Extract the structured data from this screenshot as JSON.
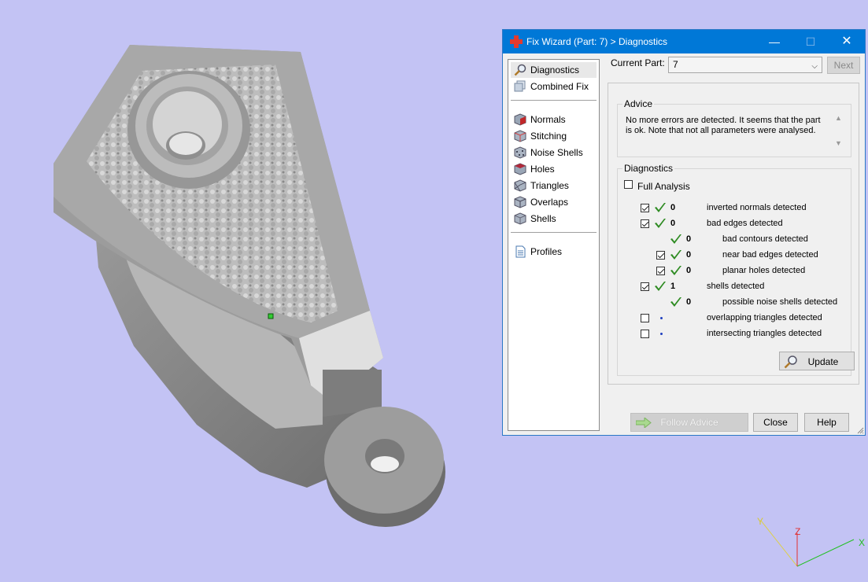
{
  "window": {
    "title": "Fix Wizard (Part: 7) > Diagnostics",
    "minimize": "—",
    "maximize": "☐",
    "close": "✕"
  },
  "nav": {
    "items": [
      {
        "label": "Diagnostics",
        "icon": "magnifier-icon",
        "selected": true
      },
      {
        "label": "Combined Fix",
        "icon": "combined-fix-icon"
      },
      {
        "label": "Normals",
        "icon": "normals-cube-icon"
      },
      {
        "label": "Stitching",
        "icon": "stitching-cube-icon"
      },
      {
        "label": "Noise Shells",
        "icon": "noise-shells-cube-icon"
      },
      {
        "label": "Holes",
        "icon": "holes-cube-icon"
      },
      {
        "label": "Triangles",
        "icon": "triangles-cube-icon"
      },
      {
        "label": "Overlaps",
        "icon": "overlaps-cube-icon"
      },
      {
        "label": "Shells",
        "icon": "shells-cube-icon"
      },
      {
        "label": "Profiles",
        "icon": "profiles-document-icon"
      }
    ]
  },
  "part": {
    "label": "Current Part:",
    "value": "7",
    "next": "Next"
  },
  "advice": {
    "title": "Advice",
    "text": "No more errors are detected. It seems that the part is ok. Note that not all parameters were analysed."
  },
  "diagnostics": {
    "title": "Diagnostics",
    "full_analysis": "Full Analysis",
    "rows": [
      {
        "checkbox": true,
        "checked": true,
        "status": "ok",
        "count": "0",
        "label": "inverted normals detected",
        "indent": 0
      },
      {
        "checkbox": true,
        "checked": true,
        "status": "ok",
        "count": "0",
        "label": "bad edges detected",
        "indent": 0
      },
      {
        "checkbox": false,
        "checked": false,
        "status": "ok",
        "count": "0",
        "label": "bad contours detected",
        "indent": 1
      },
      {
        "checkbox": true,
        "checked": true,
        "status": "ok",
        "count": "0",
        "label": "near bad edges detected",
        "indent": 1
      },
      {
        "checkbox": true,
        "checked": true,
        "status": "ok",
        "count": "0",
        "label": "planar holes detected",
        "indent": 1
      },
      {
        "checkbox": true,
        "checked": true,
        "status": "ok",
        "count": "1",
        "label": "shells detected",
        "indent": 0
      },
      {
        "checkbox": false,
        "checked": false,
        "status": "ok",
        "count": "0",
        "label": "possible noise shells detected",
        "indent": 1
      },
      {
        "checkbox": true,
        "checked": false,
        "status": "pending",
        "count": "",
        "label": "overlapping triangles detected",
        "indent": 0
      },
      {
        "checkbox": true,
        "checked": false,
        "status": "pending",
        "count": "",
        "label": "intersecting triangles detected",
        "indent": 0
      }
    ],
    "update": "Update"
  },
  "buttons": {
    "follow_advice": "Follow Advice",
    "close": "Close",
    "help": "Help"
  },
  "axes": {
    "x": "X",
    "y": "Y",
    "z": "Z"
  },
  "colors": {
    "background": "#c3c3f4",
    "titlebar": "#0078d7",
    "check_green": "#2e8b22",
    "axis_x": "#22c022",
    "axis_y": "#e0d040",
    "axis_z": "#e03030"
  }
}
